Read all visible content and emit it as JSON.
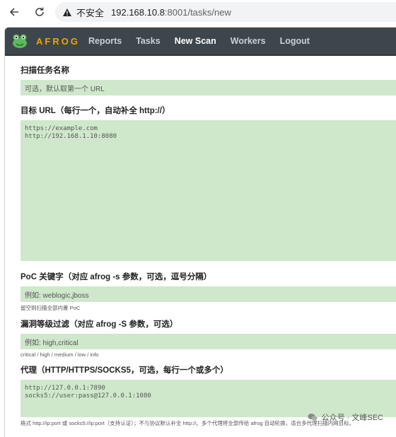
{
  "browser": {
    "security_label": "不安全",
    "url_host": "192.168.10.8",
    "url_path": ":8001/tasks/new"
  },
  "nav": {
    "brand": "AFROG",
    "links": [
      {
        "label": "Reports",
        "active": false
      },
      {
        "label": "Tasks",
        "active": false
      },
      {
        "label": "New Scan",
        "active": true
      },
      {
        "label": "Workers",
        "active": false
      },
      {
        "label": "Logout",
        "active": false
      }
    ]
  },
  "form": {
    "task_name": {
      "label": "扫描任务名称",
      "placeholder": "可选，默认取第一个 URL"
    },
    "target_urls": {
      "label": "目标 URL（每行一个，自动补全 http://）",
      "placeholder": "https://example.com\nhttp://192.168.1.10:8080"
    },
    "poc_keywords": {
      "label": "PoC 关键字（对应 afrog -s 参数，可选，逗号分隔）",
      "placeholder": "例如: weblogic,jboss",
      "hint": "留空则扫描全部内置 PoC"
    },
    "severity": {
      "label": "漏洞等级过滤（对应 afrog -S 参数，可选）",
      "placeholder": "例如: high,critical",
      "hint": "critical / high / medium / low / info"
    },
    "proxy": {
      "label": "代理（HTTP/HTTPS/SOCKS5，可选，每行一个或多个）",
      "placeholder": "http://127.0.0.1:7890\nsocks5://user:pass@127.0.0.1:1080",
      "hint": "格式 http://ip:port 或 socks5://ip:port（支持认证）；不与协议默认补全 http://。多个代理将全部传给 afrog 自动轮换，适合多代理扫描内网目标。"
    }
  },
  "watermark": "公众号 · 文峰SEC",
  "colors": {
    "nav_bg": "#3d464d",
    "brand": "#f0a500",
    "input_bg": "#cfe8cb"
  }
}
